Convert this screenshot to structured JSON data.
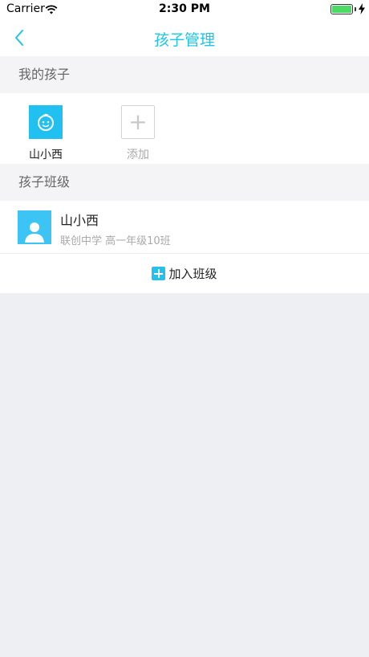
{
  "status_bar": {
    "carrier": "Carrier",
    "time": "2:30 PM"
  },
  "nav": {
    "title": "孩子管理",
    "back_icon": "chevron-left-icon"
  },
  "my_children": {
    "header": "我的孩子",
    "children": [
      {
        "name": "山小西",
        "icon": "child-face-icon"
      }
    ],
    "add_label": "添加",
    "add_icon": "plus-icon"
  },
  "child_classes": {
    "header": "孩子班级",
    "items": [
      {
        "child_name": "山小西",
        "info": "联创中学 高一年级10班",
        "icon": "person-avatar-icon"
      }
    ],
    "join_label": "加入班级",
    "join_icon": "plus-square-icon"
  },
  "colors": {
    "accent": "#1cc6e8",
    "avatar_blue": "#20c0f0",
    "background": "#eeeff3"
  }
}
